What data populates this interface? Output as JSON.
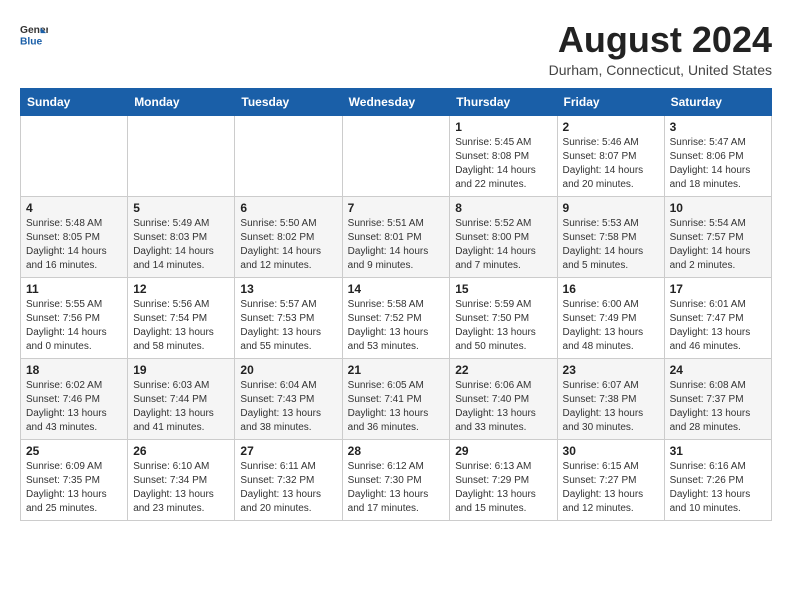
{
  "header": {
    "logo": {
      "line1": "General",
      "line2": "Blue"
    },
    "title": "August 2024",
    "location": "Durham, Connecticut, United States"
  },
  "weekdays": [
    "Sunday",
    "Monday",
    "Tuesday",
    "Wednesday",
    "Thursday",
    "Friday",
    "Saturday"
  ],
  "weeks": [
    [
      {
        "day": "",
        "info": ""
      },
      {
        "day": "",
        "info": ""
      },
      {
        "day": "",
        "info": ""
      },
      {
        "day": "",
        "info": ""
      },
      {
        "day": "1",
        "info": "Sunrise: 5:45 AM\nSunset: 8:08 PM\nDaylight: 14 hours\nand 22 minutes."
      },
      {
        "day": "2",
        "info": "Sunrise: 5:46 AM\nSunset: 8:07 PM\nDaylight: 14 hours\nand 20 minutes."
      },
      {
        "day": "3",
        "info": "Sunrise: 5:47 AM\nSunset: 8:06 PM\nDaylight: 14 hours\nand 18 minutes."
      }
    ],
    [
      {
        "day": "4",
        "info": "Sunrise: 5:48 AM\nSunset: 8:05 PM\nDaylight: 14 hours\nand 16 minutes."
      },
      {
        "day": "5",
        "info": "Sunrise: 5:49 AM\nSunset: 8:03 PM\nDaylight: 14 hours\nand 14 minutes."
      },
      {
        "day": "6",
        "info": "Sunrise: 5:50 AM\nSunset: 8:02 PM\nDaylight: 14 hours\nand 12 minutes."
      },
      {
        "day": "7",
        "info": "Sunrise: 5:51 AM\nSunset: 8:01 PM\nDaylight: 14 hours\nand 9 minutes."
      },
      {
        "day": "8",
        "info": "Sunrise: 5:52 AM\nSunset: 8:00 PM\nDaylight: 14 hours\nand 7 minutes."
      },
      {
        "day": "9",
        "info": "Sunrise: 5:53 AM\nSunset: 7:58 PM\nDaylight: 14 hours\nand 5 minutes."
      },
      {
        "day": "10",
        "info": "Sunrise: 5:54 AM\nSunset: 7:57 PM\nDaylight: 14 hours\nand 2 minutes."
      }
    ],
    [
      {
        "day": "11",
        "info": "Sunrise: 5:55 AM\nSunset: 7:56 PM\nDaylight: 14 hours\nand 0 minutes."
      },
      {
        "day": "12",
        "info": "Sunrise: 5:56 AM\nSunset: 7:54 PM\nDaylight: 13 hours\nand 58 minutes."
      },
      {
        "day": "13",
        "info": "Sunrise: 5:57 AM\nSunset: 7:53 PM\nDaylight: 13 hours\nand 55 minutes."
      },
      {
        "day": "14",
        "info": "Sunrise: 5:58 AM\nSunset: 7:52 PM\nDaylight: 13 hours\nand 53 minutes."
      },
      {
        "day": "15",
        "info": "Sunrise: 5:59 AM\nSunset: 7:50 PM\nDaylight: 13 hours\nand 50 minutes."
      },
      {
        "day": "16",
        "info": "Sunrise: 6:00 AM\nSunset: 7:49 PM\nDaylight: 13 hours\nand 48 minutes."
      },
      {
        "day": "17",
        "info": "Sunrise: 6:01 AM\nSunset: 7:47 PM\nDaylight: 13 hours\nand 46 minutes."
      }
    ],
    [
      {
        "day": "18",
        "info": "Sunrise: 6:02 AM\nSunset: 7:46 PM\nDaylight: 13 hours\nand 43 minutes."
      },
      {
        "day": "19",
        "info": "Sunrise: 6:03 AM\nSunset: 7:44 PM\nDaylight: 13 hours\nand 41 minutes."
      },
      {
        "day": "20",
        "info": "Sunrise: 6:04 AM\nSunset: 7:43 PM\nDaylight: 13 hours\nand 38 minutes."
      },
      {
        "day": "21",
        "info": "Sunrise: 6:05 AM\nSunset: 7:41 PM\nDaylight: 13 hours\nand 36 minutes."
      },
      {
        "day": "22",
        "info": "Sunrise: 6:06 AM\nSunset: 7:40 PM\nDaylight: 13 hours\nand 33 minutes."
      },
      {
        "day": "23",
        "info": "Sunrise: 6:07 AM\nSunset: 7:38 PM\nDaylight: 13 hours\nand 30 minutes."
      },
      {
        "day": "24",
        "info": "Sunrise: 6:08 AM\nSunset: 7:37 PM\nDaylight: 13 hours\nand 28 minutes."
      }
    ],
    [
      {
        "day": "25",
        "info": "Sunrise: 6:09 AM\nSunset: 7:35 PM\nDaylight: 13 hours\nand 25 minutes."
      },
      {
        "day": "26",
        "info": "Sunrise: 6:10 AM\nSunset: 7:34 PM\nDaylight: 13 hours\nand 23 minutes."
      },
      {
        "day": "27",
        "info": "Sunrise: 6:11 AM\nSunset: 7:32 PM\nDaylight: 13 hours\nand 20 minutes."
      },
      {
        "day": "28",
        "info": "Sunrise: 6:12 AM\nSunset: 7:30 PM\nDaylight: 13 hours\nand 17 minutes."
      },
      {
        "day": "29",
        "info": "Sunrise: 6:13 AM\nSunset: 7:29 PM\nDaylight: 13 hours\nand 15 minutes."
      },
      {
        "day": "30",
        "info": "Sunrise: 6:15 AM\nSunset: 7:27 PM\nDaylight: 13 hours\nand 12 minutes."
      },
      {
        "day": "31",
        "info": "Sunrise: 6:16 AM\nSunset: 7:26 PM\nDaylight: 13 hours\nand 10 minutes."
      }
    ]
  ]
}
